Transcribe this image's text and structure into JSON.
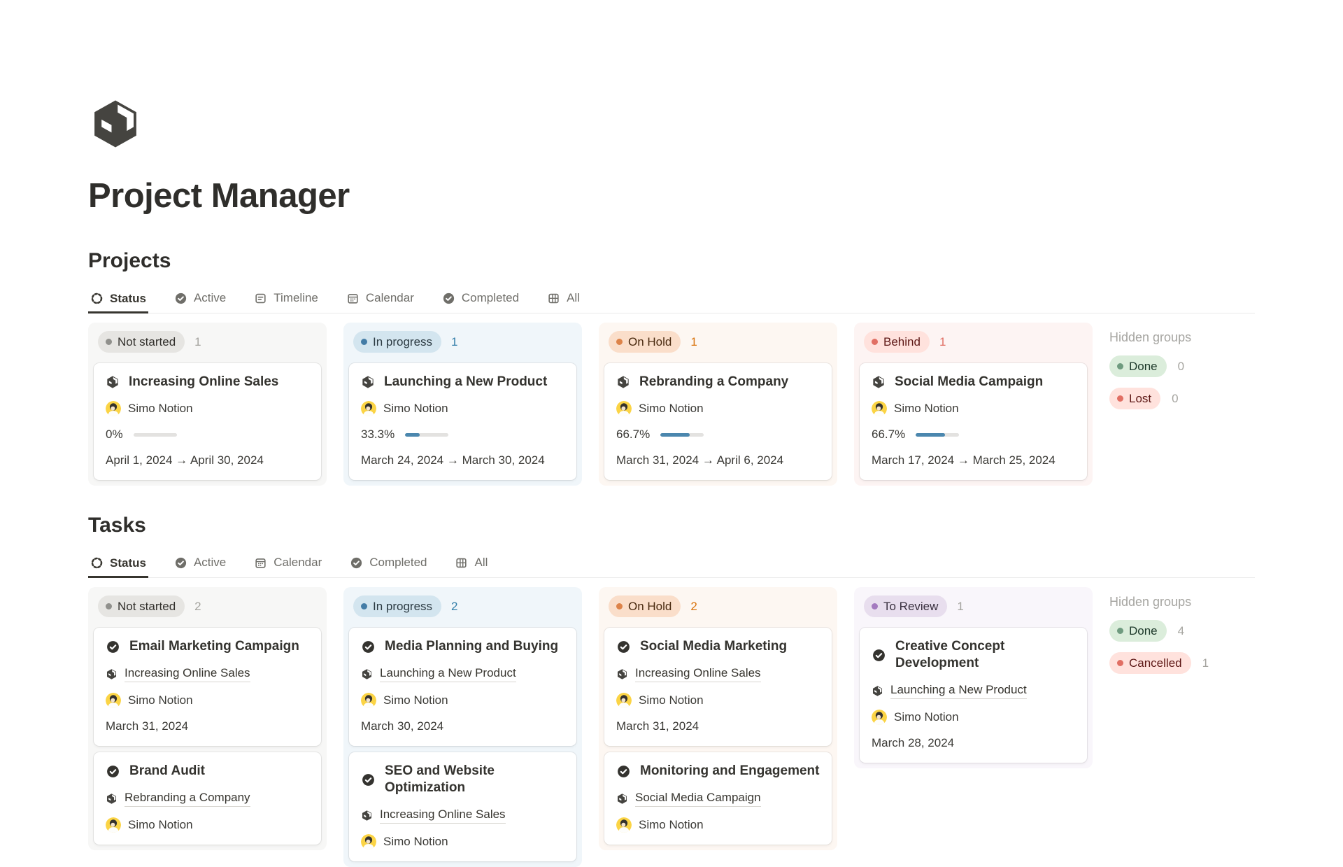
{
  "page": {
    "title": "Project Manager",
    "logo_icon": "package-icon"
  },
  "card_icons": {
    "project_card": "package-icon",
    "task_card": "check-circle-icon",
    "related_project": "package-icon",
    "person": "avatar-icon"
  },
  "projects": {
    "heading": "Projects",
    "tabs": [
      {
        "label": "Status",
        "icon": "dashed-circle-icon",
        "active": true
      },
      {
        "label": "Active",
        "icon": "check-circle-icon"
      },
      {
        "label": "Timeline",
        "icon": "timeline-icon"
      },
      {
        "label": "Calendar",
        "icon": "calendar-icon"
      },
      {
        "label": "Completed",
        "icon": "check-circle-icon"
      },
      {
        "label": "All",
        "icon": "grid-icon"
      }
    ],
    "columns": [
      {
        "status": "Not started",
        "count": "1",
        "color": "gray",
        "cards": [
          {
            "title": "Increasing Online Sales",
            "person": "Simo Notion",
            "progress_label": "0%",
            "progress_pct": 0,
            "dates": "April 1, 2024 → April 30, 2024"
          }
        ]
      },
      {
        "status": "In progress",
        "count": "1",
        "color": "blue",
        "cards": [
          {
            "title": "Launching a New Product",
            "person": "Simo Notion",
            "progress_label": "33.3%",
            "progress_pct": 33.3,
            "dates": "March 24, 2024 → March 30, 2024"
          }
        ]
      },
      {
        "status": "On Hold",
        "count": "1",
        "color": "orange",
        "cards": [
          {
            "title": "Rebranding a Company",
            "person": "Simo Notion",
            "progress_label": "66.7%",
            "progress_pct": 66.7,
            "dates": "March 31, 2024 → April 6, 2024"
          }
        ]
      },
      {
        "status": "Behind",
        "count": "1",
        "color": "red",
        "cards": [
          {
            "title": "Social Media Campaign",
            "person": "Simo Notion",
            "progress_label": "66.7%",
            "progress_pct": 66.7,
            "dates": "March 17, 2024 → March 25, 2024"
          }
        ]
      }
    ],
    "hidden_groups": {
      "label": "Hidden groups",
      "items": [
        {
          "label": "Done",
          "count": "0",
          "color": "green"
        },
        {
          "label": "Lost",
          "count": "0",
          "color": "red"
        }
      ]
    }
  },
  "tasks": {
    "heading": "Tasks",
    "tabs": [
      {
        "label": "Status",
        "icon": "dashed-circle-icon",
        "active": true
      },
      {
        "label": "Active",
        "icon": "check-circle-icon"
      },
      {
        "label": "Calendar",
        "icon": "calendar-icon"
      },
      {
        "label": "Completed",
        "icon": "check-circle-icon"
      },
      {
        "label": "All",
        "icon": "grid-icon"
      }
    ],
    "columns": [
      {
        "status": "Not started",
        "count": "2",
        "color": "gray",
        "cards": [
          {
            "title": "Email Marketing Campaign",
            "project": "Increasing Online Sales",
            "person": "Simo Notion",
            "date": "March 31, 2024"
          },
          {
            "title": "Brand Audit",
            "project": "Rebranding a Company",
            "person": "Simo Notion"
          }
        ]
      },
      {
        "status": "In progress",
        "count": "2",
        "color": "blue",
        "cards": [
          {
            "title": "Media Planning and Buying",
            "project": "Launching a New Product",
            "person": "Simo Notion",
            "date": "March 30, 2024"
          },
          {
            "title": "SEO and Website Optimization",
            "project": "Increasing Online Sales",
            "person": "Simo Notion"
          }
        ]
      },
      {
        "status": "On Hold",
        "count": "2",
        "color": "orange",
        "cards": [
          {
            "title": "Social Media Marketing",
            "project": "Increasing Online Sales",
            "person": "Simo Notion",
            "date": "March 31, 2024"
          },
          {
            "title": "Monitoring and Engagement",
            "project": "Social Media Campaign",
            "person": "Simo Notion"
          }
        ]
      },
      {
        "status": "To Review",
        "count": "1",
        "color": "purple",
        "cards": [
          {
            "title": "Creative Concept Development",
            "project": "Launching a New Product",
            "person": "Simo Notion",
            "date": "March 28, 2024"
          }
        ]
      }
    ],
    "hidden_groups": {
      "label": "Hidden groups",
      "items": [
        {
          "label": "Done",
          "count": "4",
          "color": "green"
        },
        {
          "label": "Cancelled",
          "count": "1",
          "color": "red"
        }
      ]
    }
  },
  "colors": {
    "page_text": "#37352f",
    "logo": "#454440",
    "progress_fill": "#4b87ae",
    "progress_track": "#e3e2e0",
    "avatar_yellow": "#fbd445",
    "tab_inactive": "#6f6e69",
    "divider": "#ebebea",
    "status": {
      "gray": {
        "chip_bg": "#e6e5e2",
        "dot": "#90908c",
        "text": "#32302c",
        "count": "#a5a49f",
        "col_bg": "#f7f7f6"
      },
      "blue": {
        "chip_bg": "#d3e5ef",
        "dot": "#437ca6",
        "text": "#2b3a42",
        "count": "#337ea9",
        "col_bg": "#f0f6fa"
      },
      "orange": {
        "chip_bg": "#fadeca",
        "dot": "#dd8349",
        "text": "#49290e",
        "count": "#d9730d",
        "col_bg": "#fdf7f2"
      },
      "red": {
        "chip_bg": "#ffe2dd",
        "dot": "#e16f64",
        "text": "#5d1715",
        "count": "#e16f64",
        "col_bg": "#fdf4f3"
      },
      "purple": {
        "chip_bg": "#e8deee",
        "dot": "#a379bf",
        "text": "#39303f",
        "count": "#a5a49f",
        "col_bg": "#f9f6fb"
      },
      "green": {
        "chip_bg": "#dbeddb",
        "dot": "#6f9b7f",
        "text": "#1c3829",
        "count": "#a5a49f",
        "col_bg": "#f6faf6"
      }
    }
  }
}
